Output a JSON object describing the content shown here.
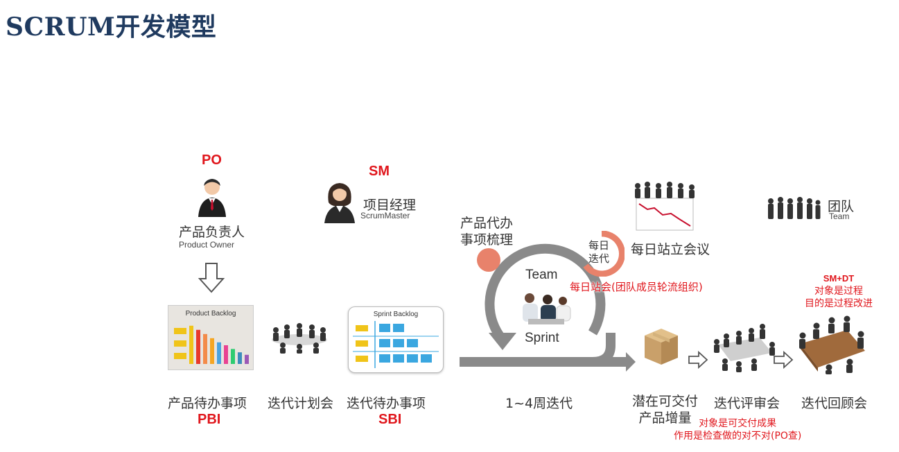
{
  "title": "SCRUM开发模型",
  "roles": {
    "po": {
      "tag": "PO",
      "cn": "产品负责人",
      "en": "Product Owner"
    },
    "sm": {
      "tag": "SM",
      "cn": "项目经理",
      "en": "ScrumMaster"
    },
    "team": {
      "cn": "团队",
      "en": "Team"
    }
  },
  "backlog_grooming": {
    "line1": "产品代办",
    "line2": "事项梳理"
  },
  "daily": {
    "badge_line1": "每日",
    "badge_line2": "迭代",
    "label": "每日站立会议",
    "note": "每日站会(团队成员轮流组织)"
  },
  "sprint_loop": {
    "top": "Team",
    "bottom": "Sprint",
    "duration": "1~4周迭代"
  },
  "product_backlog": {
    "title": "Product Backlog",
    "label": "产品待办事项",
    "tag": "PBI"
  },
  "planning": {
    "label": "迭代计划会"
  },
  "sprint_backlog": {
    "title": "Sprint Backlog",
    "label": "迭代待办事项",
    "tag": "SBI"
  },
  "increment": {
    "line1": "潜在可交付",
    "line2": "产品增量"
  },
  "review": {
    "label": "迭代评审会",
    "note_line1": "对象是可交付成果",
    "note_line2": "作用是检查做的对不对(PO查)"
  },
  "retro": {
    "label": "迭代回顾会",
    "note_line1": "SM+DT",
    "note_line2": "对象是过程",
    "note_line3": "目的是过程改进"
  },
  "colors": {
    "title": "#1f3a5f",
    "red": "#e0161c",
    "loop_gray": "#8a8a8a",
    "orange": "#e8826b",
    "bars": [
      "#f0c419",
      "#e8392b",
      "#f38b4a",
      "#f5a623",
      "#4aa3df",
      "#e84393",
      "#2ecc71",
      "#3c8dbc",
      "#9b59b6"
    ],
    "sprint_cell": "#3aa7e0"
  },
  "product_backlog_bar_levels": [
    0.92,
    0.82,
    0.72,
    0.62,
    0.52,
    0.45,
    0.36,
    0.28,
    0.22
  ]
}
